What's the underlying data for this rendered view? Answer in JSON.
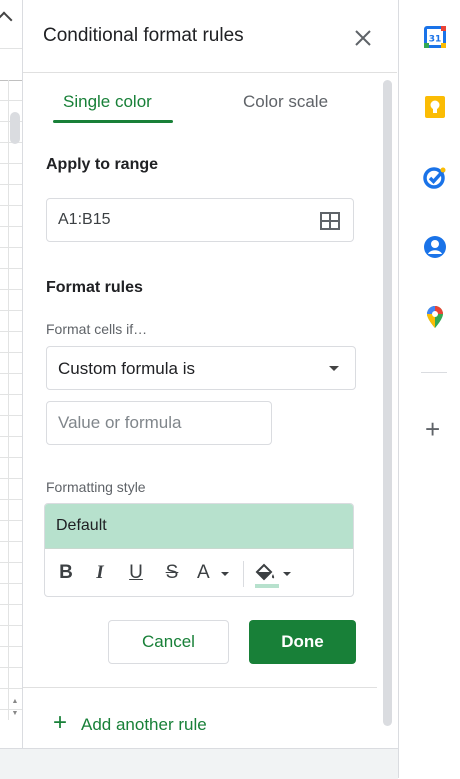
{
  "panel": {
    "title": "Conditional format rules",
    "close_icon": "close-icon"
  },
  "tabs": [
    {
      "label": "Single color",
      "active": true
    },
    {
      "label": "Color scale",
      "active": false
    }
  ],
  "apply_range": {
    "label": "Apply to range",
    "value": "A1:B15",
    "icon": "grid-select-icon"
  },
  "format_rules": {
    "label": "Format rules",
    "condition_label": "Format cells if…",
    "condition_value": "Custom formula is",
    "value_placeholder": "Value or formula"
  },
  "formatting_style": {
    "label": "Formatting style",
    "preview_text": "Default",
    "preview_color": "#b7e1cd",
    "toolbar": {
      "bold": "B",
      "italic": "I",
      "underline": "U",
      "strikethrough": "S",
      "text_color": "A",
      "fill_icon": "fill-color-icon"
    }
  },
  "buttons": {
    "cancel": "Cancel",
    "done": "Done"
  },
  "add_rule": {
    "icon": "+",
    "label": "Add another rule"
  },
  "side_icons": [
    "calendar-icon",
    "keep-icon",
    "tasks-icon",
    "contacts-icon",
    "maps-icon",
    "plus-icon"
  ],
  "calendar_day": "31",
  "colors": {
    "accent": "#188038",
    "preview": "#b7e1cd"
  }
}
